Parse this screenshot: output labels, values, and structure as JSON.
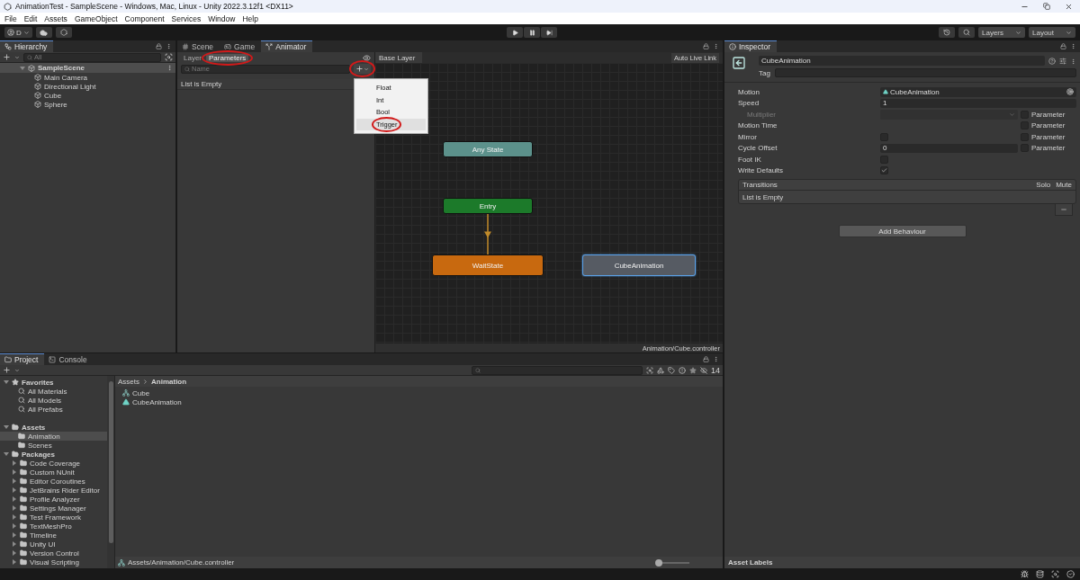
{
  "window": {
    "title": "AnimationTest - SampleScene - Windows, Mac, Linux - Unity 2022.3.12f1 <DX11>"
  },
  "menu": [
    "File",
    "Edit",
    "Assets",
    "GameObject",
    "Component",
    "Services",
    "Window",
    "Help"
  ],
  "toolbar": {
    "account": "D",
    "layers": "Layers",
    "layout": "Layout"
  },
  "hierarchy": {
    "tab": "Hierarchy",
    "search": {
      "placeholder": "All"
    },
    "scene": {
      "label": "SampleScene",
      "expanded": true,
      "selected": true,
      "children": [
        {
          "label": "Main Camera",
          "selected": false
        },
        {
          "label": "Directional Light",
          "selected": false
        },
        {
          "label": "Cube",
          "selected": false
        },
        {
          "label": "Sphere",
          "selected": false
        }
      ]
    }
  },
  "animator": {
    "tabs": [
      {
        "label": "Scene",
        "kind": "scene",
        "selected": false
      },
      {
        "label": "Game",
        "kind": "game",
        "selected": false
      },
      {
        "label": "Animator",
        "kind": "animator",
        "selected": true
      }
    ],
    "panel_tabs": [
      {
        "label": "Layer",
        "selected": false,
        "circled": false
      },
      {
        "label": "Parameters",
        "selected": true,
        "circled": true
      }
    ],
    "search": {
      "placeholder": "Name"
    },
    "add_button": {
      "circled": true,
      "open": true
    },
    "add_menu": [
      {
        "label": "Float",
        "selected": false,
        "circled": false
      },
      {
        "label": "Int",
        "selected": false,
        "circled": false
      },
      {
        "label": "Bool",
        "selected": false,
        "circled": false
      },
      {
        "label": "Trigger",
        "selected": true,
        "circled": true
      }
    ],
    "parameters_empty": "List is Empty",
    "breadcrumb": "Base Layer",
    "live_link": "Auto Live Link",
    "states": [
      {
        "label": "Any State",
        "kind": "any",
        "selected": false
      },
      {
        "label": "Entry",
        "kind": "entry",
        "selected": false
      },
      {
        "label": "WaitState",
        "kind": "default",
        "selected": false
      },
      {
        "label": "CubeAnimation",
        "kind": "normal",
        "selected": true
      }
    ],
    "path": "Animation/Cube.controller"
  },
  "inspector": {
    "tab": "Inspector",
    "name": "CubeAnimation",
    "tag_label": "Tag",
    "properties": [
      {
        "label": "Motion",
        "kind": "object",
        "value": "CubeAnimation",
        "disabled": false
      },
      {
        "label": "Speed",
        "kind": "number",
        "value": "1",
        "disabled": false,
        "children": [
          {
            "label": "Multiplier",
            "kind": "dropdown",
            "disabled": true,
            "parameter": {
              "label": "Parameter",
              "checked": false
            }
          }
        ]
      },
      {
        "label": "Motion Time",
        "kind": "none",
        "disabled": false,
        "parameter": {
          "label": "Parameter",
          "checked": false
        }
      },
      {
        "label": "Mirror",
        "kind": "checkbox",
        "checked": false,
        "disabled": false,
        "parameter": {
          "label": "Parameter",
          "checked": false
        }
      },
      {
        "label": "Cycle Offset",
        "kind": "number",
        "value": "0",
        "disabled": false,
        "parameter": {
          "label": "Parameter",
          "checked": false
        }
      },
      {
        "label": "Foot IK",
        "kind": "checkbox",
        "checked": false,
        "disabled": false
      },
      {
        "label": "Write Defaults",
        "kind": "checkbox",
        "checked": true,
        "disabled": false
      }
    ],
    "transitions": {
      "title": "Transitions",
      "columns": [
        "Solo",
        "Mute"
      ],
      "empty": "List is Empty"
    },
    "add_behaviour": "Add Behaviour",
    "asset_labels": "Asset Labels"
  },
  "project": {
    "tabs": [
      {
        "label": "Project",
        "kind": "project",
        "selected": true
      },
      {
        "label": "Console",
        "kind": "console",
        "selected": false
      }
    ],
    "hidden_count": "14",
    "size_slider": {
      "level": 0.05
    },
    "tree": [
      {
        "label": "Favorites",
        "kind": "favorites",
        "expanded": true,
        "selected": false,
        "children": [
          {
            "label": "All Materials",
            "kind": "search",
            "selected": false
          },
          {
            "label": "All Models",
            "kind": "search",
            "selected": false
          },
          {
            "label": "All Prefabs",
            "kind": "search",
            "selected": false
          }
        ]
      },
      {
        "label": "Assets",
        "kind": "root",
        "expanded": true,
        "selected": false,
        "children": [
          {
            "label": "Animation",
            "kind": "folder",
            "selected": true
          },
          {
            "label": "Scenes",
            "kind": "folder",
            "selected": false
          }
        ]
      },
      {
        "label": "Packages",
        "kind": "root",
        "expanded": true,
        "selected": false,
        "children": [
          {
            "label": "Code Coverage",
            "kind": "folder",
            "expanded": false,
            "selected": false
          },
          {
            "label": "Custom NUnit",
            "kind": "folder",
            "expanded": false,
            "selected": false
          },
          {
            "label": "Editor Coroutines",
            "kind": "folder",
            "expanded": false,
            "selected": false
          },
          {
            "label": "JetBrains Rider Editor",
            "kind": "folder",
            "expanded": false,
            "selected": false
          },
          {
            "label": "Profile Analyzer",
            "kind": "folder",
            "expanded": false,
            "selected": false
          },
          {
            "label": "Settings Manager",
            "kind": "folder",
            "expanded": false,
            "selected": false
          },
          {
            "label": "Test Framework",
            "kind": "folder",
            "expanded": false,
            "selected": false
          },
          {
            "label": "TextMeshPro",
            "kind": "folder",
            "expanded": false,
            "selected": false
          },
          {
            "label": "Timeline",
            "kind": "folder",
            "expanded": false,
            "selected": false
          },
          {
            "label": "Unity UI",
            "kind": "folder",
            "expanded": false,
            "selected": false
          },
          {
            "label": "Version Control",
            "kind": "folder",
            "expanded": false,
            "selected": false
          },
          {
            "label": "Visual Scripting",
            "kind": "folder",
            "expanded": false,
            "selected": false
          }
        ]
      }
    ],
    "breadcrumb": [
      "Assets",
      "Animation"
    ],
    "items": [
      {
        "label": "Cube",
        "kind": "controller"
      },
      {
        "label": "CubeAnimation",
        "kind": "clip"
      }
    ],
    "path": "Assets/Animation/Cube.controller"
  }
}
